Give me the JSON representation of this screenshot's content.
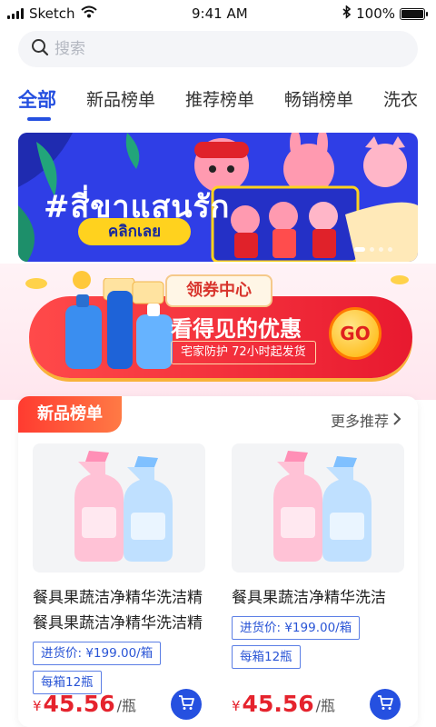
{
  "status_bar": {
    "carrier": "Sketch",
    "time": "9:41 AM",
    "battery": "100%",
    "battery_level": 1.0
  },
  "search": {
    "placeholder": "搜索"
  },
  "tabs": [
    {
      "label": "全部",
      "active": true
    },
    {
      "label": "新品榜单",
      "active": false
    },
    {
      "label": "推荐榜单",
      "active": false
    },
    {
      "label": "畅销榜单",
      "active": false
    },
    {
      "label": "洗衣",
      "active": false
    }
  ],
  "banner": {
    "title": "#สี่ขาแสนรัก",
    "cta": "คลิกเลย",
    "slides": 4,
    "active_slide": 1
  },
  "coupon": {
    "tag": "领券中心",
    "headline": "看得见的优惠",
    "subline": "宅家防护 72小时起发货",
    "go": "GO"
  },
  "section": {
    "title": "新品榜单",
    "more": "更多推荐",
    "products": [
      {
        "title": "餐具果蔬洁净精华洗洁精餐具果蔬洁净精华洗洁精",
        "price_tag": "进货价: ¥199.00/箱",
        "pack": "每箱12瓶",
        "currency": "¥",
        "price": "45.56",
        "unit": "/瓶"
      },
      {
        "title": "餐具果蔬洁净精华洗洁",
        "price_tag": "进货价: ¥199.00/箱",
        "pack": "每箱12瓶",
        "currency": "¥",
        "price": "45.56",
        "unit": "/瓶"
      }
    ]
  },
  "colors": {
    "accent": "#2550e0",
    "price": "#e5232d",
    "banner_bg": "#2f3ee6",
    "coupon_red": "#e8192f"
  },
  "icons": {
    "search": "search-icon",
    "wifi": "wifi-icon",
    "bluetooth": "bluetooth-icon",
    "chevron": "chevron-right-icon",
    "cart": "cart-icon"
  }
}
